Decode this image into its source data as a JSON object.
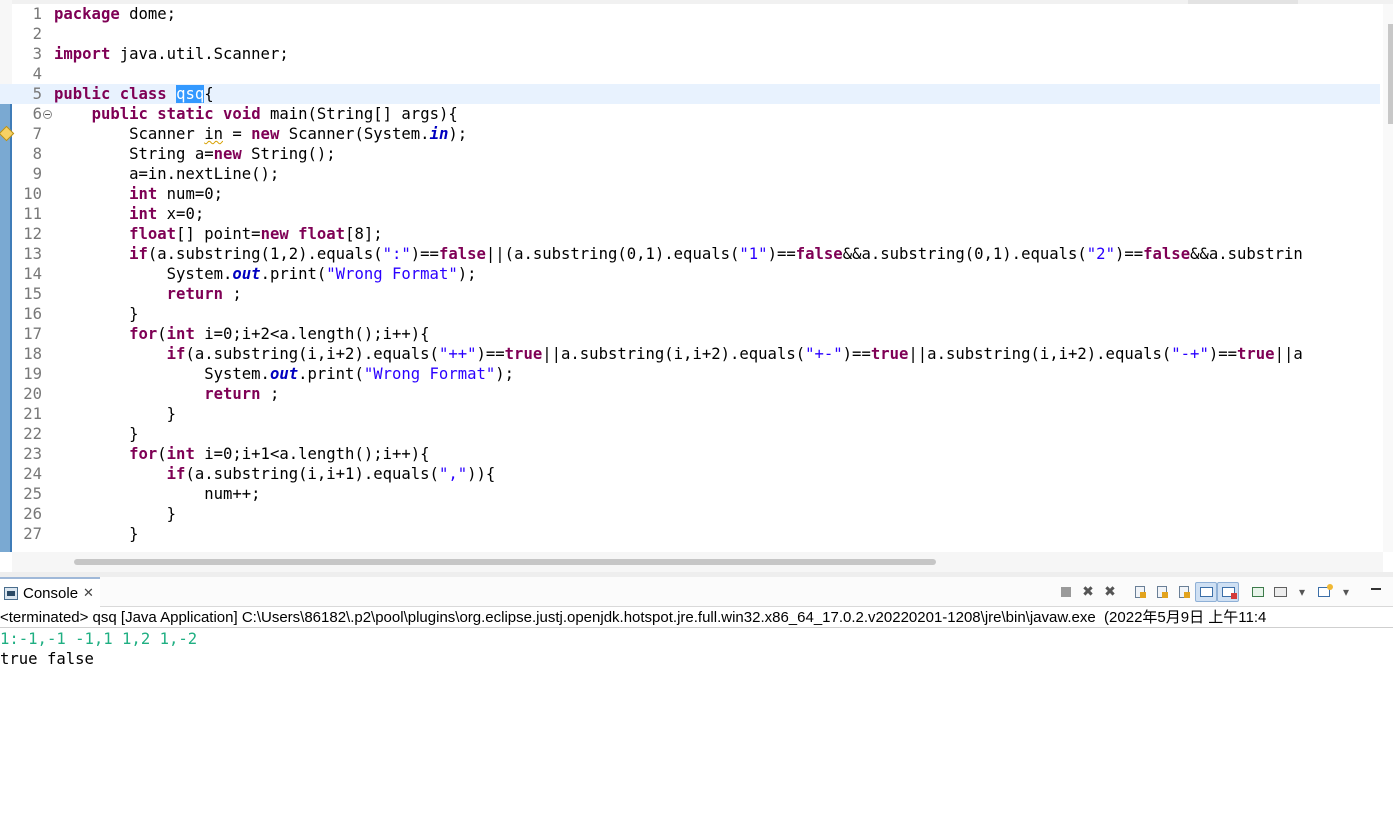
{
  "editor": {
    "current_line_index": 4,
    "selected_text": "qsq",
    "lines": [
      {
        "n": "1",
        "tokens": [
          [
            "kw",
            "package"
          ],
          [
            "t",
            " dome;"
          ]
        ]
      },
      {
        "n": "2",
        "tokens": []
      },
      {
        "n": "3",
        "tokens": [
          [
            "kw",
            "import"
          ],
          [
            "t",
            " java.util.Scanner;"
          ]
        ]
      },
      {
        "n": "4",
        "tokens": []
      },
      {
        "n": "5",
        "tokens": [
          [
            "kw",
            "public"
          ],
          [
            "t",
            " "
          ],
          [
            "kw",
            "class"
          ],
          [
            "t",
            " "
          ],
          [
            "sel",
            "qsq"
          ],
          [
            "t",
            "{"
          ]
        ]
      },
      {
        "n": "6",
        "fold": true,
        "tokens": [
          [
            "t",
            "    "
          ],
          [
            "kw",
            "public"
          ],
          [
            "t",
            " "
          ],
          [
            "kw",
            "static"
          ],
          [
            "t",
            " "
          ],
          [
            "kw",
            "void"
          ],
          [
            "t",
            " main(String[] args){"
          ]
        ]
      },
      {
        "n": "7",
        "warning": true,
        "tokens": [
          [
            "t",
            "        Scanner "
          ],
          [
            "warn",
            "in"
          ],
          [
            "t",
            " = "
          ],
          [
            "kw",
            "new"
          ],
          [
            "t",
            " Scanner(System."
          ],
          [
            "fld",
            "in"
          ],
          [
            "t",
            ");"
          ]
        ]
      },
      {
        "n": "8",
        "tokens": [
          [
            "t",
            "        String a="
          ],
          [
            "kw",
            "new"
          ],
          [
            "t",
            " String();"
          ]
        ]
      },
      {
        "n": "9",
        "tokens": [
          [
            "t",
            "        a=in.nextLine();"
          ]
        ]
      },
      {
        "n": "10",
        "tokens": [
          [
            "t",
            "        "
          ],
          [
            "kw",
            "int"
          ],
          [
            "t",
            " num=0;"
          ]
        ]
      },
      {
        "n": "11",
        "tokens": [
          [
            "t",
            "        "
          ],
          [
            "kw",
            "int"
          ],
          [
            "t",
            " x=0;"
          ]
        ]
      },
      {
        "n": "12",
        "tokens": [
          [
            "t",
            "        "
          ],
          [
            "kw",
            "float"
          ],
          [
            "t",
            "[] point="
          ],
          [
            "kw",
            "new"
          ],
          [
            "t",
            " "
          ],
          [
            "kw",
            "float"
          ],
          [
            "t",
            "[8];"
          ]
        ]
      },
      {
        "n": "13",
        "tokens": [
          [
            "t",
            "        "
          ],
          [
            "kw",
            "if"
          ],
          [
            "t",
            "(a.substring(1,2).equals("
          ],
          [
            "str",
            "\":\""
          ],
          [
            "t",
            ")=="
          ],
          [
            "kw",
            "false"
          ],
          [
            "t",
            "||(a.substring(0,1).equals("
          ],
          [
            "str",
            "\"1\""
          ],
          [
            "t",
            ")=="
          ],
          [
            "kw",
            "false"
          ],
          [
            "t",
            "&&a.substring(0,1).equals("
          ],
          [
            "str",
            "\"2\""
          ],
          [
            "t",
            ")=="
          ],
          [
            "kw",
            "false"
          ],
          [
            "t",
            "&&a.substrin"
          ]
        ]
      },
      {
        "n": "14",
        "tokens": [
          [
            "t",
            "            System."
          ],
          [
            "fld",
            "out"
          ],
          [
            "t",
            ".print("
          ],
          [
            "str",
            "\"Wrong Format\""
          ],
          [
            "t",
            ");"
          ]
        ]
      },
      {
        "n": "15",
        "tokens": [
          [
            "t",
            "            "
          ],
          [
            "kw",
            "return"
          ],
          [
            "t",
            " ;"
          ]
        ]
      },
      {
        "n": "16",
        "tokens": [
          [
            "t",
            "        }"
          ]
        ]
      },
      {
        "n": "17",
        "tokens": [
          [
            "t",
            "        "
          ],
          [
            "kw",
            "for"
          ],
          [
            "t",
            "("
          ],
          [
            "kw",
            "int"
          ],
          [
            "t",
            " i=0;i+2<a.length();i++){"
          ]
        ]
      },
      {
        "n": "18",
        "tokens": [
          [
            "t",
            "            "
          ],
          [
            "kw",
            "if"
          ],
          [
            "t",
            "(a.substring(i,i+2).equals("
          ],
          [
            "str",
            "\"++\""
          ],
          [
            "t",
            ")=="
          ],
          [
            "kw",
            "true"
          ],
          [
            "t",
            "||a.substring(i,i+2).equals("
          ],
          [
            "str",
            "\"+-\""
          ],
          [
            "t",
            ")=="
          ],
          [
            "kw",
            "true"
          ],
          [
            "t",
            "||a.substring(i,i+2).equals("
          ],
          [
            "str",
            "\"-+\""
          ],
          [
            "t",
            ")=="
          ],
          [
            "kw",
            "true"
          ],
          [
            "t",
            "||a"
          ]
        ]
      },
      {
        "n": "19",
        "tokens": [
          [
            "t",
            "                System."
          ],
          [
            "fld",
            "out"
          ],
          [
            "t",
            ".print("
          ],
          [
            "str",
            "\"Wrong Format\""
          ],
          [
            "t",
            ");"
          ]
        ]
      },
      {
        "n": "20",
        "tokens": [
          [
            "t",
            "                "
          ],
          [
            "kw",
            "return"
          ],
          [
            "t",
            " ;"
          ]
        ]
      },
      {
        "n": "21",
        "tokens": [
          [
            "t",
            "            }"
          ]
        ]
      },
      {
        "n": "22",
        "tokens": [
          [
            "t",
            "        }"
          ]
        ]
      },
      {
        "n": "23",
        "tokens": [
          [
            "t",
            "        "
          ],
          [
            "kw",
            "for"
          ],
          [
            "t",
            "("
          ],
          [
            "kw",
            "int"
          ],
          [
            "t",
            " i=0;i+1<a.length();i++){"
          ]
        ]
      },
      {
        "n": "24",
        "tokens": [
          [
            "t",
            "            "
          ],
          [
            "kw",
            "if"
          ],
          [
            "t",
            "(a.substring(i,i+1).equals("
          ],
          [
            "str",
            "\",\""
          ],
          [
            "t",
            "))"
          ],
          [
            "t",
            "{"
          ]
        ]
      },
      {
        "n": "25",
        "tokens": [
          [
            "t",
            "                num++;"
          ]
        ]
      },
      {
        "n": "26",
        "tokens": [
          [
            "t",
            "            }"
          ]
        ]
      },
      {
        "n": "27",
        "tokens": [
          [
            "t",
            "        }"
          ]
        ]
      }
    ]
  },
  "console": {
    "tab_label": "Console",
    "tab_icon": "console-icon",
    "toolbar_icons": [
      "terminate-icon",
      "remove-launch-icon",
      "remove-all-terminated-icon",
      "clear-console-icon",
      "scroll-lock-icon",
      "word-wrap-icon",
      "show-on-stdout-icon",
      "show-on-stderr-icon",
      "pin-console-icon",
      "display-selected-console-icon",
      "open-console-icon",
      "minimize-icon"
    ],
    "header": "<terminated> qsq [Java Application] C:\\Users\\86182\\.p2\\pool\\plugins\\org.eclipse.justj.openjdk.hotspot.jre.full.win32.x86_64_17.0.2.v20220201-1208\\jre\\bin\\javaw.exe  (2022年5月9日 上午11:4",
    "output": [
      {
        "kind": "input",
        "text": "1:-1,-1 -1,1 1,2 1,-2"
      },
      {
        "kind": "std",
        "text": "true false"
      }
    ]
  }
}
